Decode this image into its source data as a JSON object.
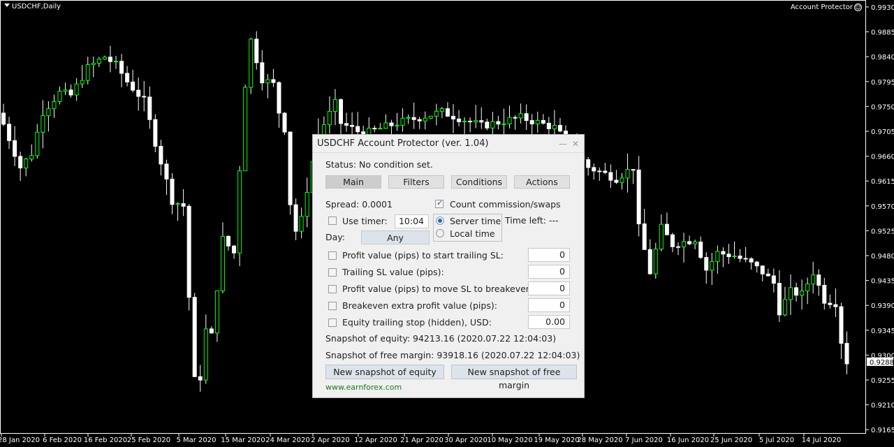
{
  "chart": {
    "symbol": "USDCHF,Daily",
    "indicator": "Account Protector",
    "current_price": "0.9288",
    "price_labels": [
      "0.9930",
      "0.9885",
      "0.9840",
      "0.9795",
      "0.9750",
      "0.9705",
      "0.9660",
      "0.9615",
      "0.9570",
      "0.9525",
      "0.9480",
      "0.9435",
      "0.9390",
      "0.9345",
      "0.9300",
      "0.9255",
      "0.9210",
      "0.9165"
    ],
    "date_labels": [
      "28 Jan 2020",
      "6 Feb 2020",
      "16 Feb 2020",
      "25 Feb 2020",
      "5 Mar 2020",
      "15 Mar 2020",
      "24 Mar 2020",
      "2 Apr 2020",
      "12 Apr 2020",
      "21 Apr 2020",
      "30 Apr 2020",
      "10 May 2020",
      "19 May 2020",
      "28 May 2020",
      "7 Jun 2020",
      "16 Jun 2020",
      "25 Jun 2020",
      "5 Jul 2020",
      "14 Jul 2020"
    ],
    "colors": {
      "up": "#00ff00",
      "down": "#ffffff"
    }
  },
  "chart_data": {
    "type": "candlestick",
    "price_range": [
      0.9165,
      0.993
    ],
    "close_waypoints": [
      [
        0,
        0.9718
      ],
      [
        3,
        0.964
      ],
      [
        5,
        0.9665
      ],
      [
        7,
        0.974
      ],
      [
        10,
        0.9775
      ],
      [
        12,
        0.977
      ],
      [
        15,
        0.982
      ],
      [
        18,
        0.984
      ],
      [
        20,
        0.9825
      ],
      [
        22,
        0.9795
      ],
      [
        25,
        0.976
      ],
      [
        27,
        0.9685
      ],
      [
        30,
        0.958
      ],
      [
        32,
        0.957
      ],
      [
        33,
        0.9405
      ],
      [
        34,
        0.9255
      ],
      [
        35,
        0.926
      ],
      [
        36,
        0.9345
      ],
      [
        37,
        0.9335
      ],
      [
        39,
        0.951
      ],
      [
        41,
        0.9485
      ],
      [
        43,
        0.979
      ],
      [
        44,
        0.987
      ],
      [
        46,
        0.98
      ],
      [
        48,
        0.979
      ],
      [
        49,
        0.974
      ],
      [
        50,
        0.971
      ],
      [
        51,
        0.9575
      ],
      [
        52,
        0.9525
      ],
      [
        53,
        0.9545
      ],
      [
        54,
        0.96
      ],
      [
        56,
        0.97
      ],
      [
        59,
        0.9755
      ],
      [
        60,
        0.972
      ],
      [
        64,
        0.97
      ],
      [
        70,
        0.972
      ],
      [
        78,
        0.974
      ],
      [
        85,
        0.9715
      ],
      [
        92,
        0.973
      ],
      [
        98,
        0.9712
      ],
      [
        104,
        0.964
      ],
      [
        109,
        0.962
      ],
      [
        112,
        0.964
      ],
      [
        113,
        0.953
      ],
      [
        115,
        0.945
      ],
      [
        117,
        0.953
      ],
      [
        119,
        0.95
      ],
      [
        123,
        0.951
      ],
      [
        125,
        0.9455
      ],
      [
        127,
        0.9485
      ],
      [
        130,
        0.948
      ],
      [
        133,
        0.9465
      ],
      [
        135,
        0.945
      ],
      [
        137,
        0.943
      ],
      [
        138,
        0.938
      ],
      [
        140,
        0.9415
      ],
      [
        142,
        0.941
      ],
      [
        144,
        0.945
      ],
      [
        146,
        0.94
      ],
      [
        148,
        0.9395
      ],
      [
        149,
        0.9325
      ],
      [
        150,
        0.9288
      ]
    ]
  },
  "dialog": {
    "title": "USDCHF Account Protector (ver. 1.04)",
    "minimize": "—",
    "close": "✕",
    "status": "Status: No condition set.",
    "tabs": [
      "Main",
      "Filters",
      "Conditions",
      "Actions"
    ],
    "spread": "Spread: 0.0001",
    "count_commission": "Count commission/swaps",
    "use_timer": "Use timer:",
    "timer_value": "10:04",
    "server_time": "Server time",
    "local_time": "Local time",
    "time_left": "Time left: ---",
    "day_label": "Day:",
    "day_value": "Any",
    "rows": [
      {
        "label": "Profit value (pips) to start trailing SL:",
        "value": "0"
      },
      {
        "label": "Trailing SL value (pips):",
        "value": "0"
      },
      {
        "label": "Profit value (pips) to move SL to breakeven:",
        "value": "0"
      },
      {
        "label": "Breakeven extra profit value (pips):",
        "value": "0"
      },
      {
        "label": "Equity trailing stop (hidden), USD:",
        "value": "0.00"
      }
    ],
    "snapshot_equity": "Snapshot of equity: 94213.16 (2020.07.22 12:04:03)",
    "snapshot_margin": "Snapshot of free margin: 93918.16 (2020.07.22 12:04:03)",
    "btn_equity": "New snapshot of equity",
    "btn_margin": "New snapshot of free margin",
    "link": "www.earnforex.com"
  }
}
